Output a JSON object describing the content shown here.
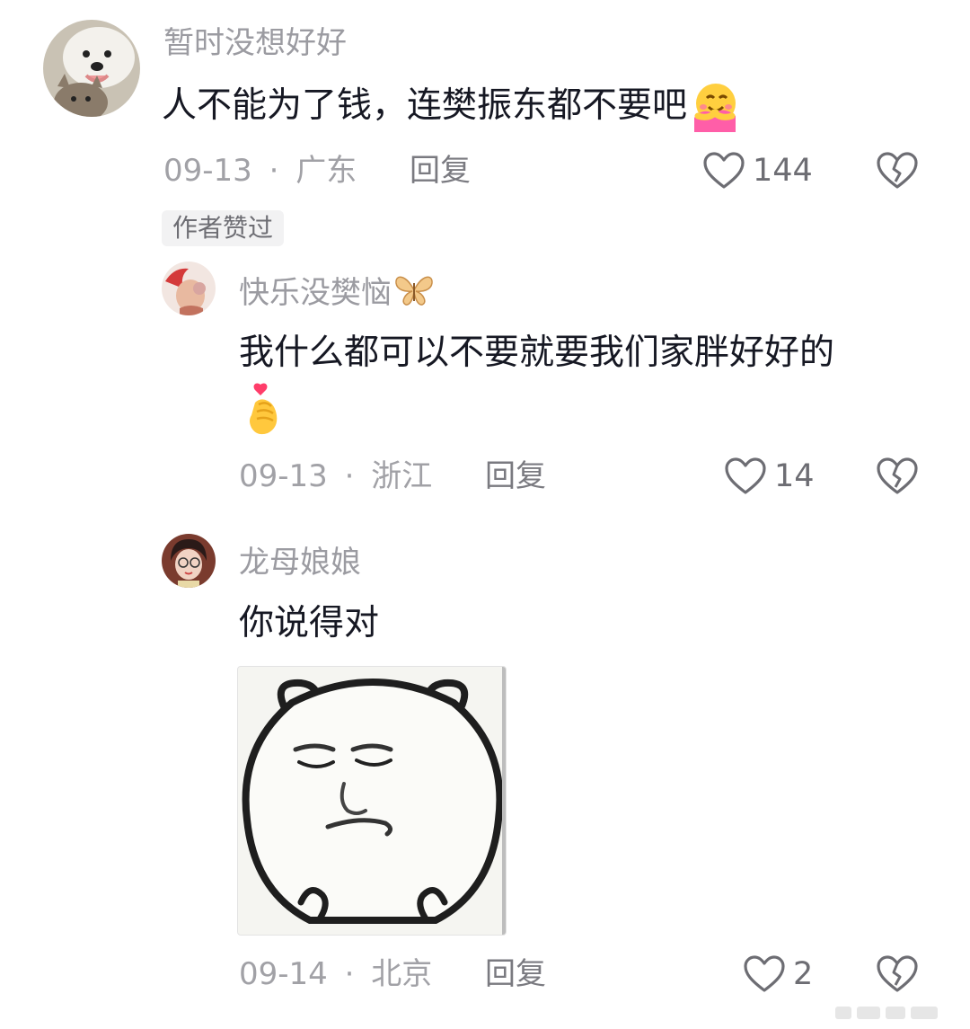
{
  "comments": [
    {
      "username": "暂时没想好好",
      "content": "人不能为了钱，连樊振东都不要吧",
      "content_emoji": "hugging-face-emoji",
      "date": "09-13",
      "separator": "·",
      "location": "广东",
      "reply_label": "回复",
      "likes": "144",
      "author_badge": "作者赞过"
    },
    {
      "username": "快乐没樊恼",
      "username_emoji": "butterfly-emoji",
      "content_line1": "我什么都可以不要就要我们家胖好好的",
      "content_emoji": "finger-heart-emoji",
      "date": "09-13",
      "separator": "·",
      "location": "浙江",
      "reply_label": "回复",
      "likes": "14"
    },
    {
      "username": "龙母娘娘",
      "content": "你说得对",
      "sticker": "panda-meme-sticker",
      "date": "09-14",
      "separator": "·",
      "location": "北京",
      "reply_label": "回复",
      "likes": "2"
    }
  ],
  "icons": {
    "like": "heart-outline-icon",
    "dislike": "broken-heart-icon"
  },
  "colors": {
    "username": "#9b9ba1",
    "content": "#161823",
    "meta": "#a1a1a6",
    "badge_bg": "#f2f2f3"
  }
}
